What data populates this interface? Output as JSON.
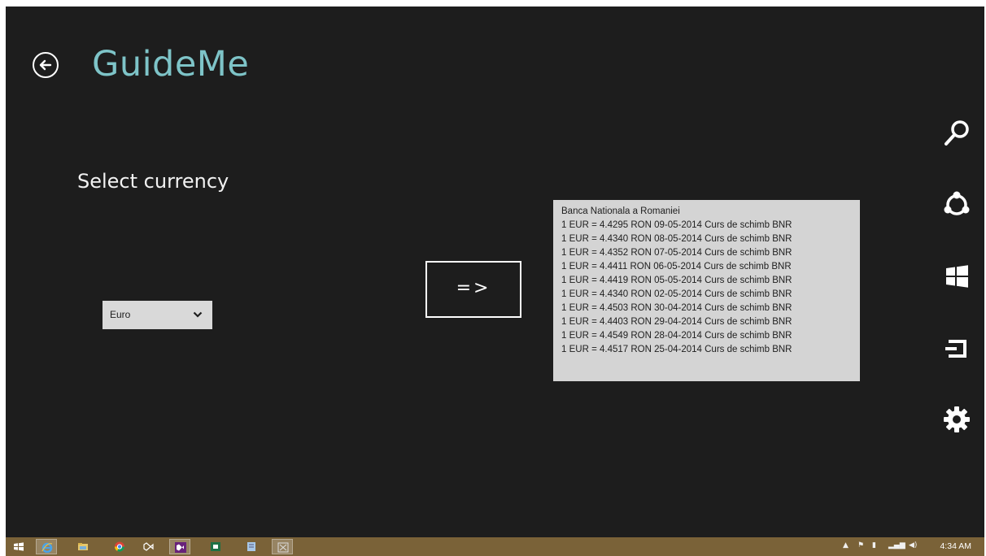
{
  "app": {
    "title": "GuideMe",
    "background_color": "#1d1d1d",
    "title_color": "#7ec4c8"
  },
  "currency": {
    "label": "Select currency",
    "selected": "Euro"
  },
  "convert_button": {
    "label": "=>"
  },
  "results": {
    "lines": [
      "Banca Nationala a Romaniei",
      "1 EUR = 4.4295 RON 09-05-2014 Curs de schimb BNR",
      "1 EUR = 4.4340 RON 08-05-2014 Curs de schimb BNR",
      "1 EUR = 4.4352 RON 07-05-2014 Curs de schimb BNR",
      "1 EUR = 4.4411 RON 06-05-2014 Curs de schimb BNR",
      "1 EUR = 4.4419 RON 05-05-2014 Curs de schimb BNR",
      "1 EUR = 4.4340 RON 02-05-2014 Curs de schimb BNR",
      "1 EUR = 4.4503 RON 30-04-2014 Curs de schimb BNR",
      "1 EUR = 4.4403 RON 29-04-2014 Curs de schimb BNR",
      "1 EUR = 4.4549 RON 28-04-2014 Curs de schimb BNR",
      "1 EUR = 4.4517 RON 25-04-2014 Curs de schimb BNR"
    ]
  },
  "charms": [
    "search-icon",
    "share-icon",
    "start-icon",
    "devices-icon",
    "settings-icon"
  ],
  "taskbar": {
    "color": "#7a6238",
    "apps": [
      "start-icon",
      "internet-explorer-icon",
      "file-explorer-icon",
      "chrome-icon",
      "visual-studio-icon",
      "visual-studio-2-icon",
      "excel-icon",
      "notepad-icon",
      "close-app-icon"
    ],
    "clock": "4:34 AM"
  }
}
